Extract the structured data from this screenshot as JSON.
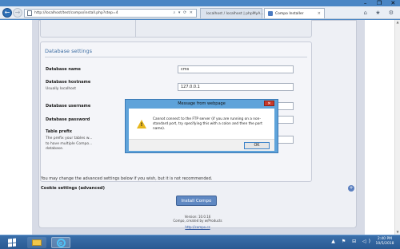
{
  "window": {
    "minimize": "–",
    "maximize": "❐",
    "close": "✕"
  },
  "browser": {
    "back_icon": "arrow-left-icon",
    "url": "http://localhost/test/compo/install.php?step=4",
    "address_tools": "⌕ ▾ ⟳ ✕",
    "tabs": [
      {
        "label": "localhost / localhost | phpMyA...",
        "favicon": "phpmyadmin-icon"
      },
      {
        "label": "Compo Installer",
        "favicon": "compo-icon",
        "close": "×"
      }
    ],
    "right_icons": "⌂ ★ ⚙"
  },
  "page": {
    "db_section": {
      "title": "Database settings",
      "fields": [
        {
          "label": "Database name",
          "value": "cms"
        },
        {
          "label": "Database hostname",
          "help": "Usually localhost",
          "value": "127.0.0.1"
        },
        {
          "label": "Database username",
          "value": ""
        },
        {
          "label": "Database password",
          "value": ""
        },
        {
          "label": "Table prefix",
          "help": "The prefix your tables w... to have multiple Compo... database.",
          "value": ""
        }
      ]
    },
    "advanced_note": "You may change the advanced settings below if you wish, but it is not recommended.",
    "cookie_label": "Cookie settings (advanced)",
    "expand_icon": "+",
    "install_button": "Install Compo",
    "footer": {
      "line1": "Version: 10.0.16",
      "line2": "Compo, created by w/Products",
      "link": "http://compo.cz"
    }
  },
  "dialog": {
    "title": "Message from webpage",
    "close": "✕",
    "message": "Cannot connect to the FTP server (if you are running on a non-standard port, try specifying this with a colon and then the port name).",
    "ok_label": "OK",
    "icon": "warning-icon"
  },
  "taskbar": {
    "tray_icons": "▲ ⚑ ⊟ ◁)",
    "time": "2:40 PM",
    "date": "10/5/2018"
  }
}
